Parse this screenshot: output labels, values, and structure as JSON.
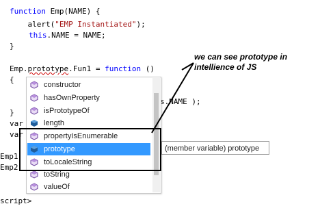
{
  "code": {
    "line1_kw": "function",
    "line1_rest": " Emp(NAME) {",
    "line2_pre": "    alert(",
    "line2_str": "\"EMP Instantiated\"",
    "line2_post": ");",
    "line3_kw": "this",
    "line3_rest": ".NAME = NAME;",
    "line4": "}",
    "line6_a": "Emp.",
    "line6_b": "prototype",
    "line6_c": ".Fun1 = ",
    "line6_kw": "function",
    "line6_d": " ()",
    "line7": "{",
    "line9_frag": "s.NAME );",
    "line10": "}",
    "line11": "var",
    "line12": "var",
    "line14": "Emp1",
    "line15": "Emp2",
    "line18": "script>"
  },
  "intellisense": {
    "items": [
      {
        "label": "constructor",
        "icon": "method-icon"
      },
      {
        "label": "hasOwnProperty",
        "icon": "method-icon"
      },
      {
        "label": "isPrototypeOf",
        "icon": "method-icon"
      },
      {
        "label": "length",
        "icon": "field-icon"
      },
      {
        "label": "propertyIsEnumerable",
        "icon": "method-icon"
      },
      {
        "label": "prototype",
        "icon": "field-icon"
      },
      {
        "label": "toLocaleString",
        "icon": "method-icon"
      },
      {
        "label": "toString",
        "icon": "method-icon"
      },
      {
        "label": "valueOf",
        "icon": "method-icon"
      }
    ],
    "selected_index": 5
  },
  "tooltip": "(member variable) prototype",
  "annotation": "we can see prototype in intellience of JS",
  "colors": {
    "keyword": "#0000ff",
    "string": "#a31515",
    "selection": "#3399ff",
    "method_icon": "#6a3f9c",
    "field_icon": "#1f5d9b"
  }
}
